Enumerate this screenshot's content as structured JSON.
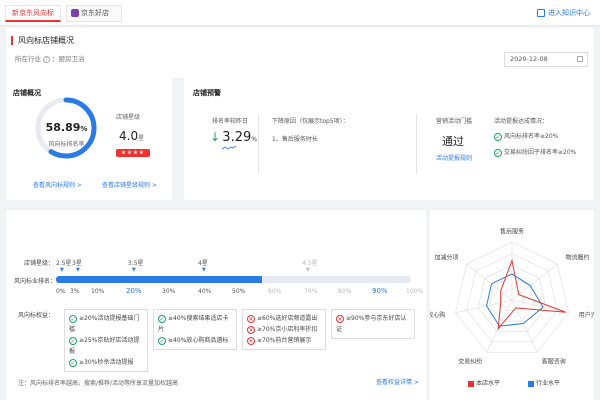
{
  "tabs": [
    {
      "label": "新京东风向标"
    },
    {
      "label": "京东好店"
    }
  ],
  "help_link": "进入知识中心",
  "header": {
    "title": "风向标店铺概况",
    "industry_label": "所在行业",
    "industry_value": "厨房卫浴",
    "date": "2020-12-08"
  },
  "overview": {
    "title": "店铺概况",
    "gauge_value": "58.89",
    "gauge_unit": "%",
    "gauge_fraction": 0.5889,
    "gauge_label": "风向标排名率",
    "level_label": "店铺星级",
    "level_value": "4.0",
    "level_unit": "星",
    "stars": "★★★★",
    "link_rules": "查看风向标规则 >",
    "link_level": "查看店铺星级规则 >"
  },
  "warning": {
    "title": "店铺预警",
    "rank_label": "排名率较昨日",
    "rank_arrow": "↓",
    "rank_value": "3.29",
    "rank_unit": "%",
    "reason_label": "下降原因（仅展示top5项）：",
    "reason_item": "1、售后服务时长",
    "campaign_label": "营销活动门槛",
    "campaign_value": "通过",
    "campaign_link": "活动提报规则",
    "campaign_tip_label": "活动提报达成情况：",
    "campaign_items": [
      "风向标排名率≥20%",
      "交易纠纷因子排名率≥20%"
    ]
  },
  "scale": {
    "level_label": "店铺星级：",
    "rank_label": "风向标业排名：",
    "fill_fraction": 0.58,
    "levels": [
      {
        "label": "2.5星",
        "active": true
      },
      {
        "label": "3星",
        "active": true
      },
      {
        "label": "3.5星",
        "active": true
      },
      {
        "label": "4星",
        "active": true
      },
      {
        "label": "4.5星",
        "active": false
      }
    ],
    "ticks": [
      {
        "label": "0%",
        "active": true,
        "big": false
      },
      {
        "label": "3%",
        "active": true,
        "big": false
      },
      {
        "label": "10%",
        "active": true,
        "big": false
      },
      {
        "label": "20%",
        "active": true,
        "big": true
      },
      {
        "label": "30%",
        "active": true,
        "big": false
      },
      {
        "label": "40%",
        "active": true,
        "big": false
      },
      {
        "label": "50%",
        "active": true,
        "big": false
      },
      {
        "label": "60%",
        "active": false,
        "big": false
      },
      {
        "label": "70%",
        "active": false,
        "big": false
      },
      {
        "label": "80%",
        "active": false,
        "big": false
      },
      {
        "label": "90%",
        "active": false,
        "big": true
      },
      {
        "label": "100%",
        "active": false,
        "big": false
      }
    ]
  },
  "privileges": {
    "label": "风向标权益：",
    "groups": [
      {
        "items": [
          {
            "ok": true,
            "text": "≥20%活动提报基础门槛"
          },
          {
            "ok": true,
            "text": "≥25%京贴好店活动提报"
          },
          {
            "ok": true,
            "text": "≥30%秒杀活动提报"
          }
        ]
      },
      {
        "items": [
          {
            "ok": true,
            "text": "≥40%搜索结果适店卡片"
          },
          {
            "ok": true,
            "text": "≥40%放心购商品遴标"
          }
        ]
      },
      {
        "items": [
          {
            "ok": false,
            "text": "≥60%选好店频道露出"
          },
          {
            "ok": false,
            "text": "≥70%京小店利率折扣"
          },
          {
            "ok": false,
            "text": "≥70%前台营销展示"
          }
        ]
      },
      {
        "items": [
          {
            "ok": false,
            "text": "≥90%参与京东好店认证"
          }
        ]
      }
    ],
    "note": "注：风向标排名率越高，搜索/推荐/活动等所享流量加权越高",
    "note_link": "查看权益详情 >"
  },
  "radar": {
    "axes": [
      "售后服务",
      "物流履约",
      "用户评价",
      "客服咨询",
      "交易纠纷",
      "放心购",
      "加减分项"
    ],
    "store": [
      0.68,
      0.15,
      0.95,
      0.15,
      0.55,
      0.2,
      0.25
    ],
    "industry": [
      0.45,
      0.4,
      0.55,
      0.45,
      0.5,
      0.45,
      0.45
    ],
    "store_color": "#e33333",
    "industry_color": "#2a7be4",
    "legend_store": "本店水平",
    "legend_industry": "行业水平"
  }
}
